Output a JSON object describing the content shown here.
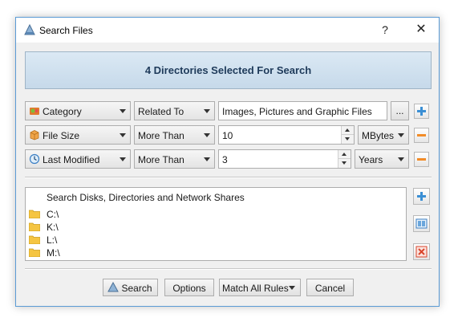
{
  "window": {
    "title": "Search Files",
    "help_glyph": "?",
    "close_glyph": "✕"
  },
  "header": {
    "text": "4 Directories Selected For Search"
  },
  "rules": [
    {
      "field": "Category",
      "field_icon": "category-icon",
      "operator": "Related To",
      "value": "Images, Pictures and Graphic Files",
      "extra_button": "..."
    },
    {
      "field": "File Size",
      "field_icon": "box-icon",
      "operator": "More Than",
      "value": "10",
      "unit": "MBytes"
    },
    {
      "field": "Last Modified",
      "field_icon": "clock-icon",
      "operator": "More Than",
      "value": "3",
      "unit": "Years"
    }
  ],
  "locations": {
    "header": "Search Disks, Directories and Network Shares",
    "items": [
      "C:\\",
      "K:\\",
      "L:\\",
      "M:\\"
    ]
  },
  "footer": {
    "search_label": "Search",
    "options_label": "Options",
    "match_label": "Match All Rules",
    "cancel_label": "Cancel"
  },
  "colors": {
    "header_text": "#1e3a5a",
    "add_blue": "#3b8fd4",
    "remove_orange": "#f28c28",
    "delete_red": "#d9452b",
    "window_border": "#5b9bd5"
  }
}
